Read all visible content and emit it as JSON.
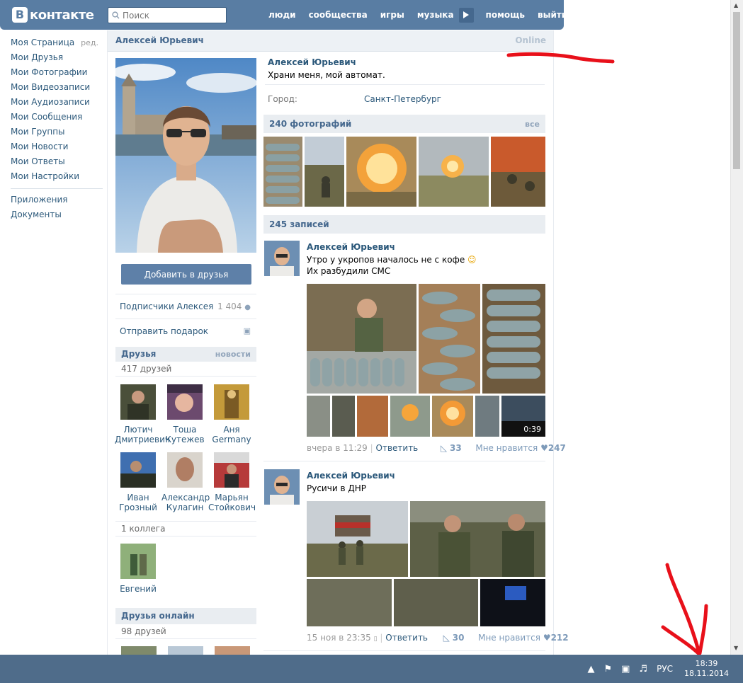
{
  "header": {
    "logo_letter": "В",
    "logo_text": "контакте",
    "search_placeholder": "Поиск",
    "nav": [
      "люди",
      "сообщества",
      "игры",
      "музыка",
      "помощь",
      "выйти"
    ]
  },
  "left_menu": {
    "edit_label": "ред.",
    "items": [
      "Моя Страница",
      "Мои Друзья",
      "Мои Фотографии",
      "Мои Видеозаписи",
      "Мои Аудиозаписи",
      "Мои Сообщения",
      "Мои Группы",
      "Мои Новости",
      "Мои Ответы",
      "Мои Настройки"
    ],
    "extra": [
      "Приложения",
      "Документы"
    ]
  },
  "profile": {
    "title_name": "Алексей Юрьевич",
    "online": "Online",
    "name": "Алексей Юрьевич",
    "status": "Храни меня, мой автомат.",
    "city_label": "Город:",
    "city": "Санкт-Петербург",
    "add_friend": "Добавить в друзья",
    "subscribers_label": "Подписчики Алексея",
    "subscribers_count": "1 404",
    "gift_label": "Отправить подарок"
  },
  "friends": {
    "title": "Друзья",
    "news": "новости",
    "count": "417 друзей",
    "list": [
      {
        "first": "Лютич",
        "last": "Дмитриевич"
      },
      {
        "first": "Тоша",
        "last": "Кутежев"
      },
      {
        "first": "Аня",
        "last": "Germany"
      },
      {
        "first": "Иван",
        "last": "Грозный"
      },
      {
        "first": "Александр",
        "last": "Кулагин"
      },
      {
        "first": "Марьян",
        "last": "Стойкович"
      }
    ],
    "colleagues_count": "1 коллега",
    "colleague": "Евгений",
    "online_title": "Друзья онлайн",
    "online_count": "98 друзей"
  },
  "photos": {
    "title": "240 фотографий",
    "all": "все"
  },
  "wall": {
    "title": "245 записей",
    "posts": [
      {
        "author": "Алексей Юрьевич",
        "text_line1": "Утро у укропов началось не с кофе",
        "text_line2": "Их разбудили СМС",
        "video_duration": "0:39",
        "time": "вчера в 11:29",
        "reply": "Ответить",
        "reposts": "33",
        "like_label": "Мне нравится",
        "likes": "247"
      },
      {
        "author": "Алексей Юрьевич",
        "text_line1": "Русичи в ДНР",
        "time": "15 ноя в 23:35",
        "reply": "Ответить",
        "reposts": "30",
        "like_label": "Мне нравится",
        "likes": "212"
      }
    ]
  },
  "taskbar": {
    "lang": "РУС",
    "time": "18:39",
    "date": "18.11.2014"
  },
  "colors": {
    "header_bg": "#597da3",
    "link": "#2b587a",
    "block_header": "#e9edf1",
    "taskbar": "#4f6c8a",
    "annotation": "#e8101a"
  }
}
